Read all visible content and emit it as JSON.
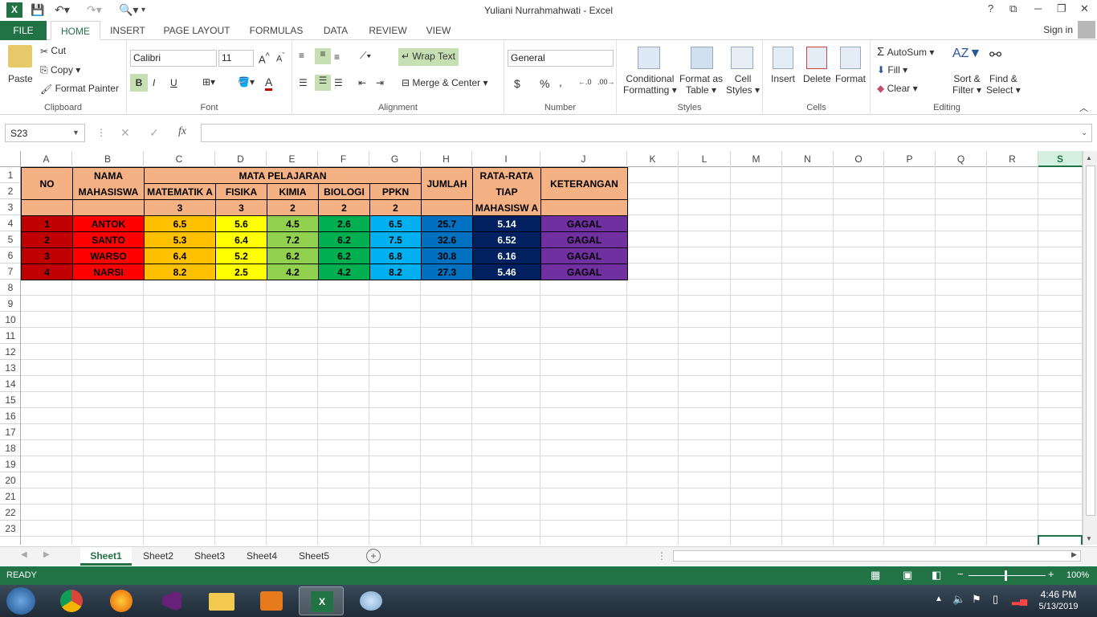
{
  "window": {
    "title": "Yuliani Nurrahmahwati - Excel",
    "help": "?",
    "sign_in": "Sign in"
  },
  "tabs": [
    "FILE",
    "HOME",
    "INSERT",
    "PAGE LAYOUT",
    "FORMULAS",
    "DATA",
    "REVIEW",
    "VIEW"
  ],
  "ribbon": {
    "clipboard": {
      "label": "Clipboard",
      "paste": "Paste",
      "cut": "Cut",
      "copy": "Copy",
      "format_painter": "Format Painter"
    },
    "font": {
      "label": "Font",
      "family": "Calibri",
      "size": "11",
      "bold": "B",
      "italic": "I",
      "underline": "U"
    },
    "alignment": {
      "label": "Alignment",
      "wrap_text": "Wrap Text",
      "merge_center": "Merge & Center"
    },
    "number": {
      "label": "Number",
      "format": "General",
      "currency": "$",
      "percent": "%",
      "comma": ","
    },
    "styles": {
      "label": "Styles",
      "conditional": "Conditional",
      "conditional2": "Formatting",
      "format_as": "Format as",
      "format_as2": "Table",
      "cell": "Cell",
      "cell2": "Styles"
    },
    "cells": {
      "label": "Cells",
      "insert": "Insert",
      "delete": "Delete",
      "format": "Format"
    },
    "editing": {
      "label": "Editing",
      "autosum": "AutoSum",
      "fill": "Fill",
      "clear": "Clear",
      "sort": "Sort &",
      "sort2": "Filter",
      "find": "Find &",
      "find2": "Select"
    }
  },
  "formula_bar": {
    "name_box": "S23",
    "fx": "fx",
    "cancel": "✕",
    "enter": "✓"
  },
  "columns": [
    "A",
    "B",
    "C",
    "D",
    "E",
    "F",
    "G",
    "H",
    "I",
    "J",
    "K",
    "L",
    "M",
    "N",
    "O",
    "P",
    "Q",
    "R",
    "S"
  ],
  "rows": [
    "1",
    "2",
    "3",
    "4",
    "5",
    "6",
    "7",
    "8",
    "9",
    "10",
    "11",
    "12",
    "13",
    "14",
    "15",
    "16",
    "17",
    "18",
    "19",
    "20",
    "21",
    "22",
    "23"
  ],
  "table": {
    "no": "NO",
    "nama": "NAMA MAHASISWA",
    "mata": "MATA PELAJARAN",
    "jumlah": "JUMLAH",
    "rata": "RATA-RATA TIAP MAHASISW A",
    "ket": "KETERANGAN",
    "subjects": [
      "MATEMATIK A",
      "FISIKA",
      "KIMIA",
      "BIOLOGI",
      "PPKN"
    ],
    "weights": [
      "3",
      "3",
      "2",
      "2",
      "2"
    ],
    "data": [
      {
        "no": "1",
        "nama": "ANTOK",
        "vals": [
          "6.5",
          "5.6",
          "4.5",
          "2.6",
          "6.5"
        ],
        "jumlah": "25.7",
        "rata": "5.14",
        "ket": "GAGAL"
      },
      {
        "no": "2",
        "nama": "SANTO",
        "vals": [
          "5.3",
          "6.4",
          "7.2",
          "6.2",
          "7.5"
        ],
        "jumlah": "32.6",
        "rata": "6.52",
        "ket": "GAGAL"
      },
      {
        "no": "3",
        "nama": "WARSO",
        "vals": [
          "6.4",
          "5.2",
          "6.2",
          "6.2",
          "6.8"
        ],
        "jumlah": "30.8",
        "rata": "6.16",
        "ket": "GAGAL"
      },
      {
        "no": "4",
        "nama": "NARSI",
        "vals": [
          "8.2",
          "2.5",
          "4.2",
          "4.2",
          "8.2"
        ],
        "jumlah": "27.3",
        "rata": "5.46",
        "ket": "GAGAL"
      }
    ]
  },
  "sheet_tabs": [
    "Sheet1",
    "Sheet2",
    "Sheet3",
    "Sheet4",
    "Sheet5"
  ],
  "status": {
    "ready": "READY",
    "zoom": "100%"
  },
  "clock": {
    "time": "4:46 PM",
    "date": "5/13/2019"
  }
}
